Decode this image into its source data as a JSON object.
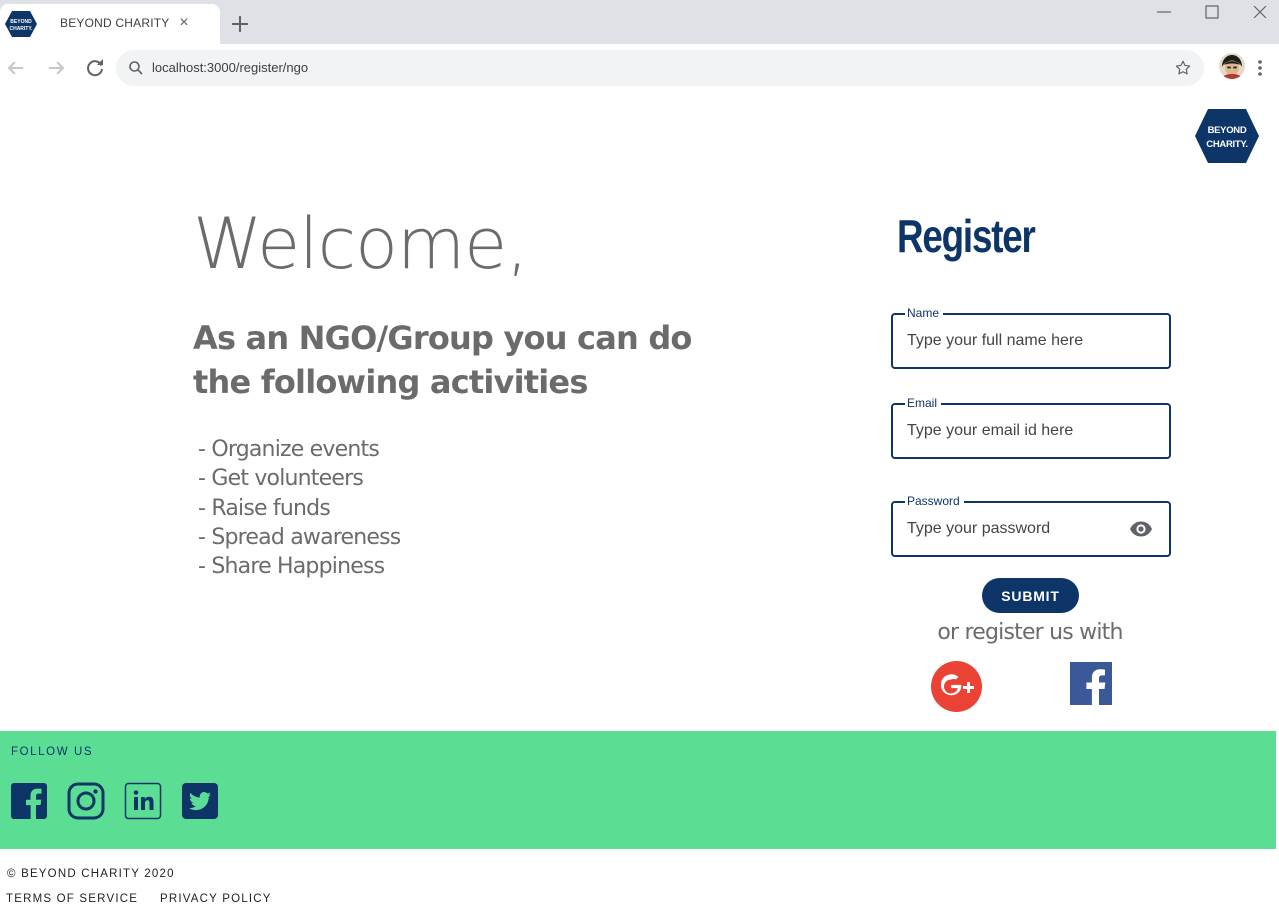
{
  "browser": {
    "tab_title": "BEYOND CHARITY",
    "tab_close": "×",
    "url": "localhost:3000/register/ngo"
  },
  "logo": {
    "line1": "BEYOND",
    "line2": "CHARITY."
  },
  "intro": {
    "welcome": "Welcome,",
    "subheading": "As an NGO/Group you can do the following activities",
    "activities": [
      "- Organize events",
      "- Get volunteers",
      "- Raise funds",
      "- Spread awareness",
      "- Share Happiness"
    ]
  },
  "register": {
    "title": "Register",
    "fields": {
      "name": {
        "label": "Name",
        "placeholder": "Type your full name here",
        "value": ""
      },
      "email": {
        "label": "Email",
        "placeholder": "Type your email id here",
        "value": ""
      },
      "password": {
        "label": "Password",
        "placeholder": "Type your password",
        "value": ""
      }
    },
    "submit_label": "SUBMIT",
    "alt_text": "or register us with"
  },
  "footer": {
    "follow_label": "FOLLOW US",
    "copyright": "© BEYOND CHARITY 2020",
    "terms": "TERMS OF SERVICE",
    "privacy": "PRIVACY POLICY"
  },
  "colors": {
    "brand_navy": "#0d3567",
    "footer_green": "#5cdd94",
    "google_red": "#ea4335",
    "facebook_blue": "#3b5998"
  },
  "icons": [
    "browser-favicon",
    "new-tab-icon",
    "minimize-icon",
    "maximize-icon",
    "close-window-icon",
    "back-icon",
    "forward-icon",
    "reload-icon",
    "search-icon",
    "star-icon",
    "profile-avatar",
    "menu-dots-icon",
    "eye-icon",
    "google-plus-icon",
    "facebook-icon",
    "instagram-icon",
    "linkedin-icon",
    "twitter-icon"
  ]
}
